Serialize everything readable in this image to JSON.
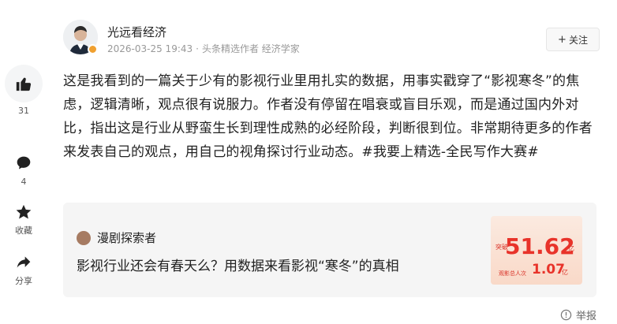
{
  "sidebar": {
    "like": {
      "icon": "thumbs-up-icon",
      "count": "31"
    },
    "comment": {
      "icon": "comment-icon",
      "count": "4"
    },
    "favorite": {
      "icon": "star-icon",
      "label": "收藏"
    },
    "share": {
      "icon": "share-icon",
      "label": "分享"
    }
  },
  "author": {
    "name": "光远看经济",
    "date": "2026-03-25 19:43",
    "separator": "·",
    "meta": "头条精选作者 经济学家",
    "follow_label": "关注",
    "follow_plus": "+"
  },
  "post": {
    "text": "这是我看到的一篇关于少有的影视行业里用扎实的数据，用事实戳穿了“影视寒冬”的焦虑，逻辑清晰，观点很有说服力。作者没有停留在唱衰或盲目乐观，而是通过国内外对比，指出这是行业从野蛮生长到理性成熟的必经阶段，判断很到位。非常期待更多的作者来发表自己的观点，用自己的视角探讨行业动态。#我要上精选-全民写作大赛#"
  },
  "quoted": {
    "author": "漫剧探索者",
    "title": "影视行业还会有春天么？用数据来看影视“寒冬”的真相",
    "thumbnail": {
      "label1": "突破",
      "number1": "51.62",
      "unit1": "亿",
      "label2": "观影总人次",
      "number2": "1.07",
      "unit2": "亿"
    }
  },
  "report": {
    "label": "举报",
    "icon": "report-icon"
  },
  "colors": {
    "accent": "#e8332a",
    "badge": "#f0a030",
    "card_bg": "#f5f5f5"
  }
}
